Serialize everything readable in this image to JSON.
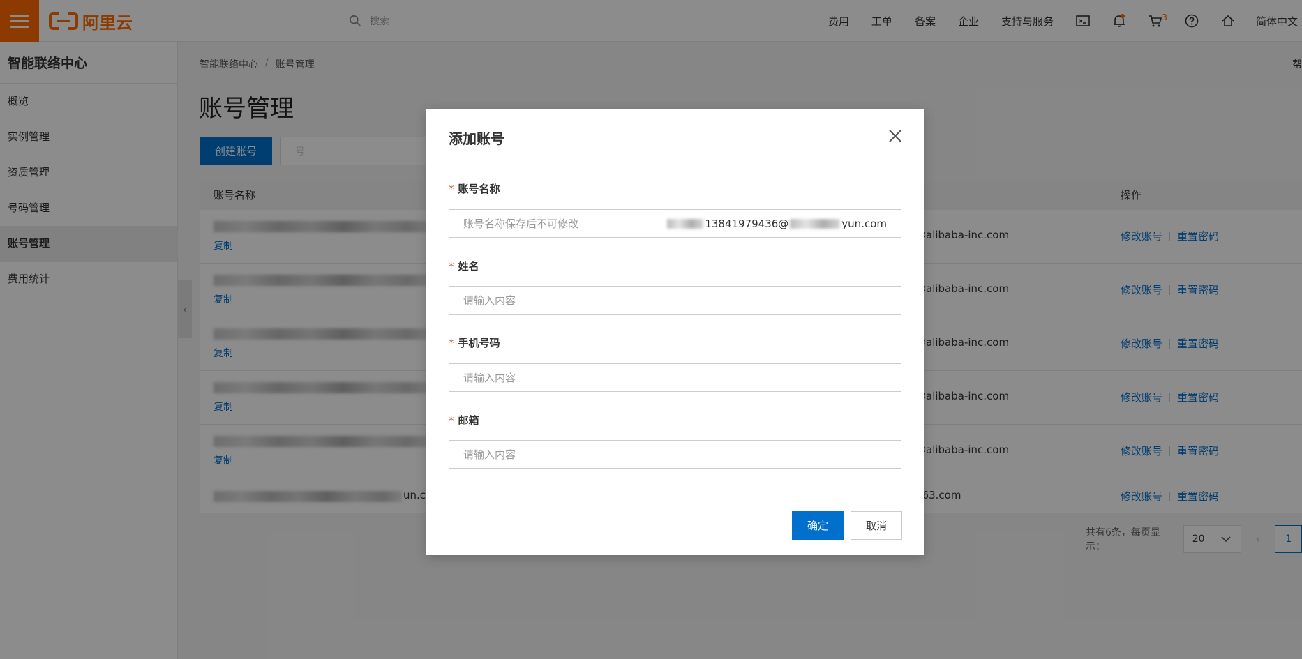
{
  "topbar": {
    "logo_text": "阿里云",
    "search_placeholder": "搜索",
    "nav_items": [
      "费用",
      "工单",
      "备案",
      "企业",
      "支持与服务"
    ],
    "cart_count": "3",
    "language": "简体中文",
    "accent_color": "#ff6a00"
  },
  "sidebar": {
    "title": "智能联络中心",
    "items": [
      {
        "label": "概览"
      },
      {
        "label": "实例管理"
      },
      {
        "label": "资质管理"
      },
      {
        "label": "号码管理"
      },
      {
        "label": "账号管理",
        "active": true
      },
      {
        "label": "费用统计"
      }
    ]
  },
  "main": {
    "breadcrumb": [
      "智能联络中心",
      "账号管理"
    ],
    "breadcrumb_sep": "/",
    "help_text": "帮",
    "title": "账号管理",
    "create_button": "创建账号",
    "filter_placeholder": "号",
    "table": {
      "headers": {
        "name": "账号名称",
        "ops": "操作"
      },
      "rows": [
        {
          "copy": "复制",
          "email": "@alibaba-inc.com",
          "edit": "修改账号",
          "reset": "重置密码"
        },
        {
          "copy": "复制",
          "email": "@alibaba-inc.com",
          "edit": "修改账号",
          "reset": "重置密码"
        },
        {
          "copy": "复制",
          "email": "@alibaba-inc.com",
          "edit": "修改账号",
          "reset": "重置密码"
        },
        {
          "copy": "复制",
          "email": "@alibaba-inc.com",
          "edit": "修改账号",
          "reset": "重置密码"
        },
        {
          "copy": "复制",
          "email": "@alibaba-inc.com",
          "edit": "修改账号",
          "reset": "重置密码"
        },
        {
          "name_suffix": "un.c",
          "email": "163.com",
          "edit": "修改账号",
          "reset": "重置密码"
        }
      ]
    },
    "pager": {
      "summary": "共有6条，每页显示：",
      "page_size": "20",
      "current_page": "1"
    }
  },
  "dialog": {
    "title": "添加账号",
    "fields": {
      "account_name": {
        "label": "账号名称",
        "placeholder": "账号名称保存后不可修改",
        "value_mid": "13841979436@",
        "value_tail": "yun.com"
      },
      "full_name": {
        "label": "姓名",
        "placeholder": "请输入内容"
      },
      "phone": {
        "label": "手机号码",
        "placeholder": "请输入内容"
      },
      "email": {
        "label": "邮箱",
        "placeholder": "请输入内容"
      }
    },
    "required_mark": "*",
    "ok_label": "确定",
    "cancel_label": "取消"
  }
}
